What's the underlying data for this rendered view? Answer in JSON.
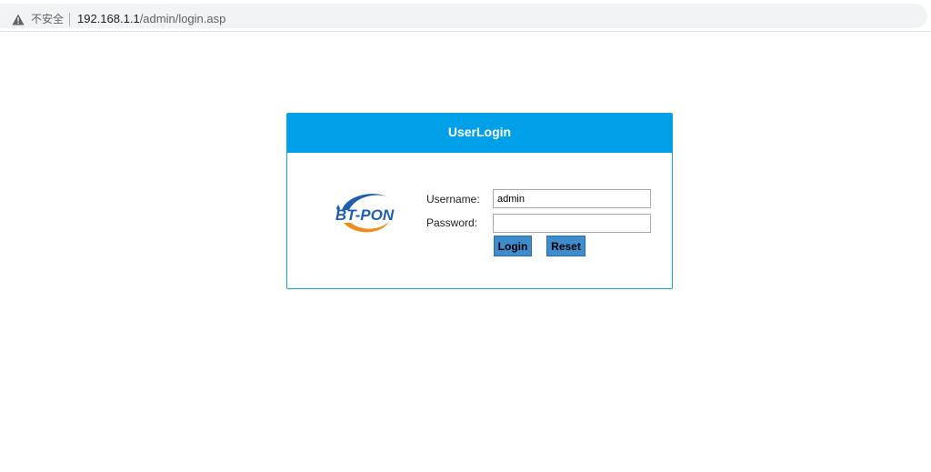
{
  "browser": {
    "security_label": "不安全",
    "url_host": "192.168.1.1",
    "url_path": "/admin/login.asp"
  },
  "login": {
    "title": "UserLogin",
    "logo_text": "BT-PON",
    "username_label": "Username:",
    "username_value": "admin",
    "password_label": "Password:",
    "password_value": "",
    "login_button": "Login",
    "reset_button": "Reset"
  },
  "colors": {
    "header_bg": "#00a0e8",
    "button_bg": "#3f8ccc",
    "logo_blue": "#1f5fae",
    "logo_orange": "#f08c1e"
  }
}
